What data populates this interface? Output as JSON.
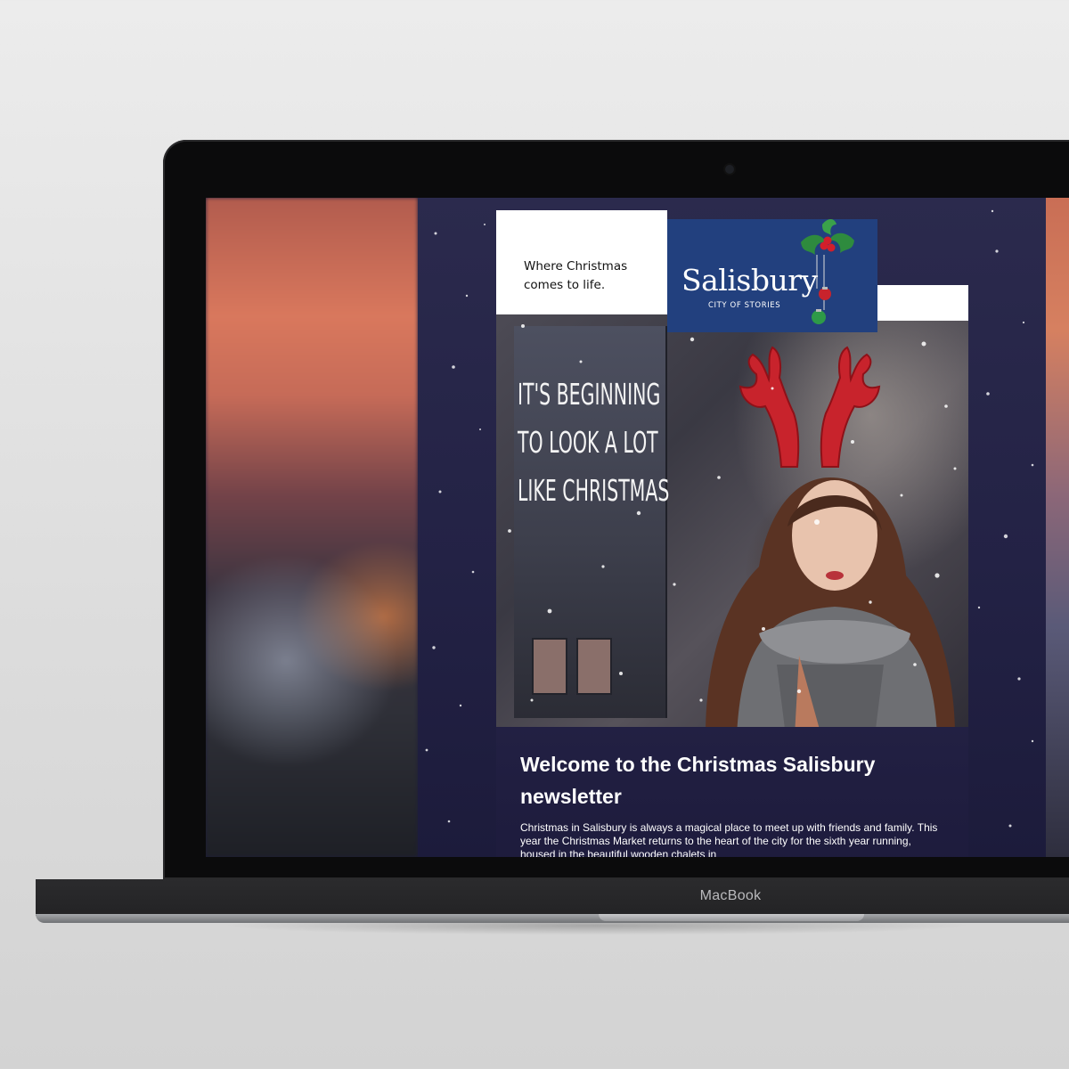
{
  "device": {
    "brand_label": "MacBook"
  },
  "newsletter": {
    "tagline": "Where Christmas comes to life.",
    "logo": {
      "wordmark": "Salisbury",
      "subtitle": "CITY OF STORIES"
    },
    "hero": {
      "headline_lines": [
        "It's beginning",
        "to look a lot",
        "like Christmas"
      ]
    },
    "content": {
      "heading": "Welcome to the Christmas Salisbury newsletter",
      "body": "Christmas in Salisbury is always a magical place to meet up with friends and family. This year the Christmas Market returns to the heart of the city for the sixth year running, housed in the beautiful wooden chalets in"
    }
  },
  "colors": {
    "email_background": "#232245",
    "logo_panel": "#22407e",
    "antlers_red": "#c8232c",
    "holly_green": "#2e8b3e"
  },
  "icons": [
    "holly-icon",
    "star-icon",
    "red-bauble-icon",
    "green-bauble-icon",
    "camera-icon"
  ]
}
